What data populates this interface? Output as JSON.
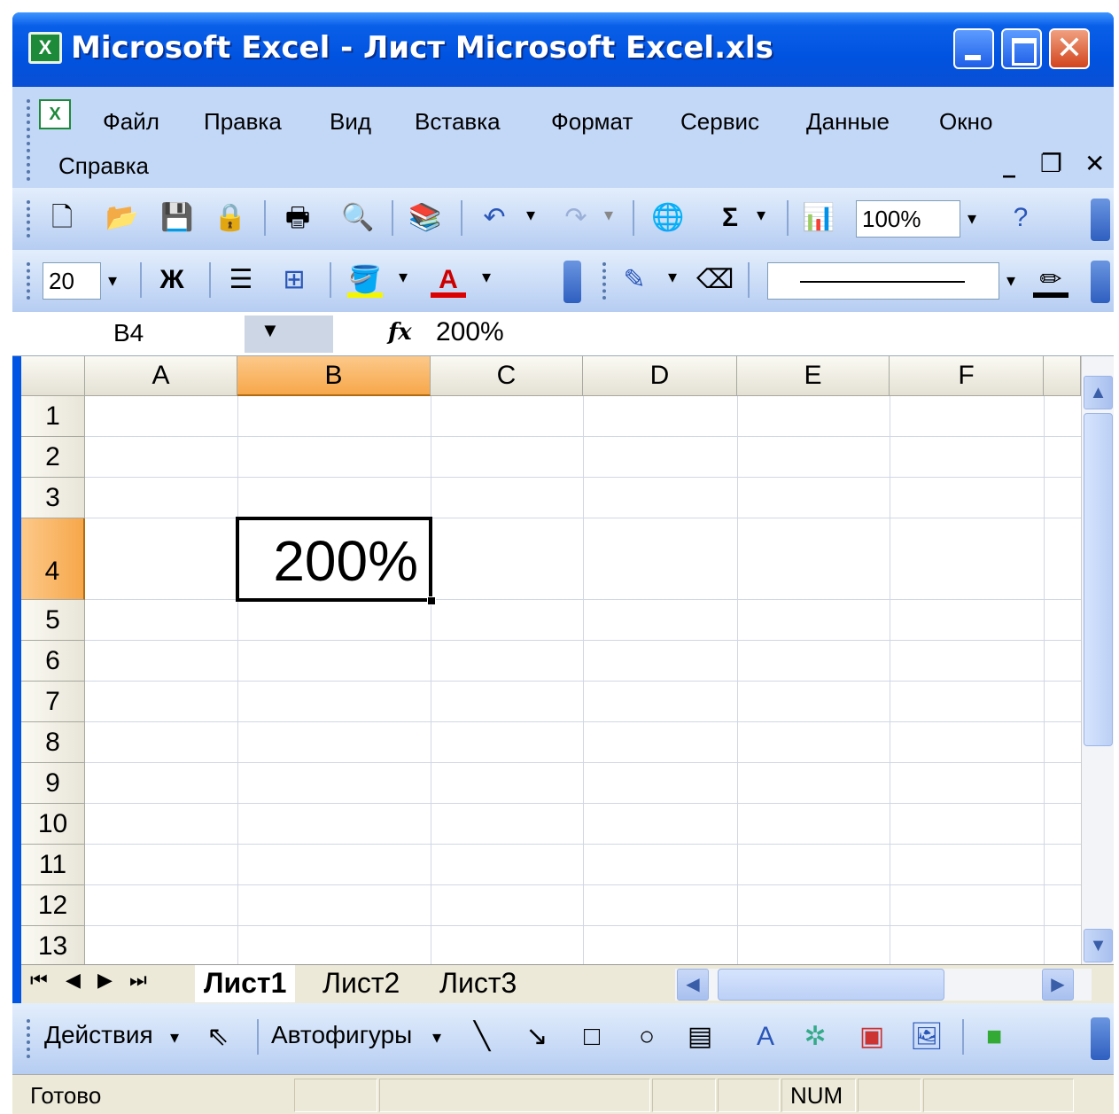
{
  "window": {
    "title": "Microsoft Excel - Лист Microsoft Excel.xls",
    "app_icon": "X"
  },
  "menu": {
    "items": [
      "Файл",
      "Правка",
      "Вид",
      "Вставка",
      "Формат",
      "Сервис",
      "Данные",
      "Окно",
      "Справка"
    ]
  },
  "toolbar_standard": {
    "zoom": "100%"
  },
  "toolbar_format": {
    "font_size": "20",
    "bold_label": "Ж"
  },
  "formula_bar": {
    "name_box": "B4",
    "fx_label": "fx",
    "value": "200%"
  },
  "grid": {
    "columns": [
      "A",
      "B",
      "C",
      "D",
      "E",
      "F"
    ],
    "rows": [
      "1",
      "2",
      "3",
      "4",
      "5",
      "6",
      "7",
      "8",
      "9",
      "10",
      "11",
      "12",
      "13"
    ],
    "selected_column": "B",
    "selected_row": "4",
    "active_cell_value": "200%"
  },
  "sheets": {
    "tabs": [
      "Лист1",
      "Лист2",
      "Лист3"
    ],
    "active": "Лист1"
  },
  "drawing": {
    "actions_label": "Действия",
    "autoshapes_label": "Автофигуры"
  },
  "status": {
    "ready": "Готово",
    "num": "NUM"
  },
  "colors": {
    "titlebar": "#0053e0",
    "selection": "#f7a74a",
    "toolbar": "#c3d7f7"
  }
}
